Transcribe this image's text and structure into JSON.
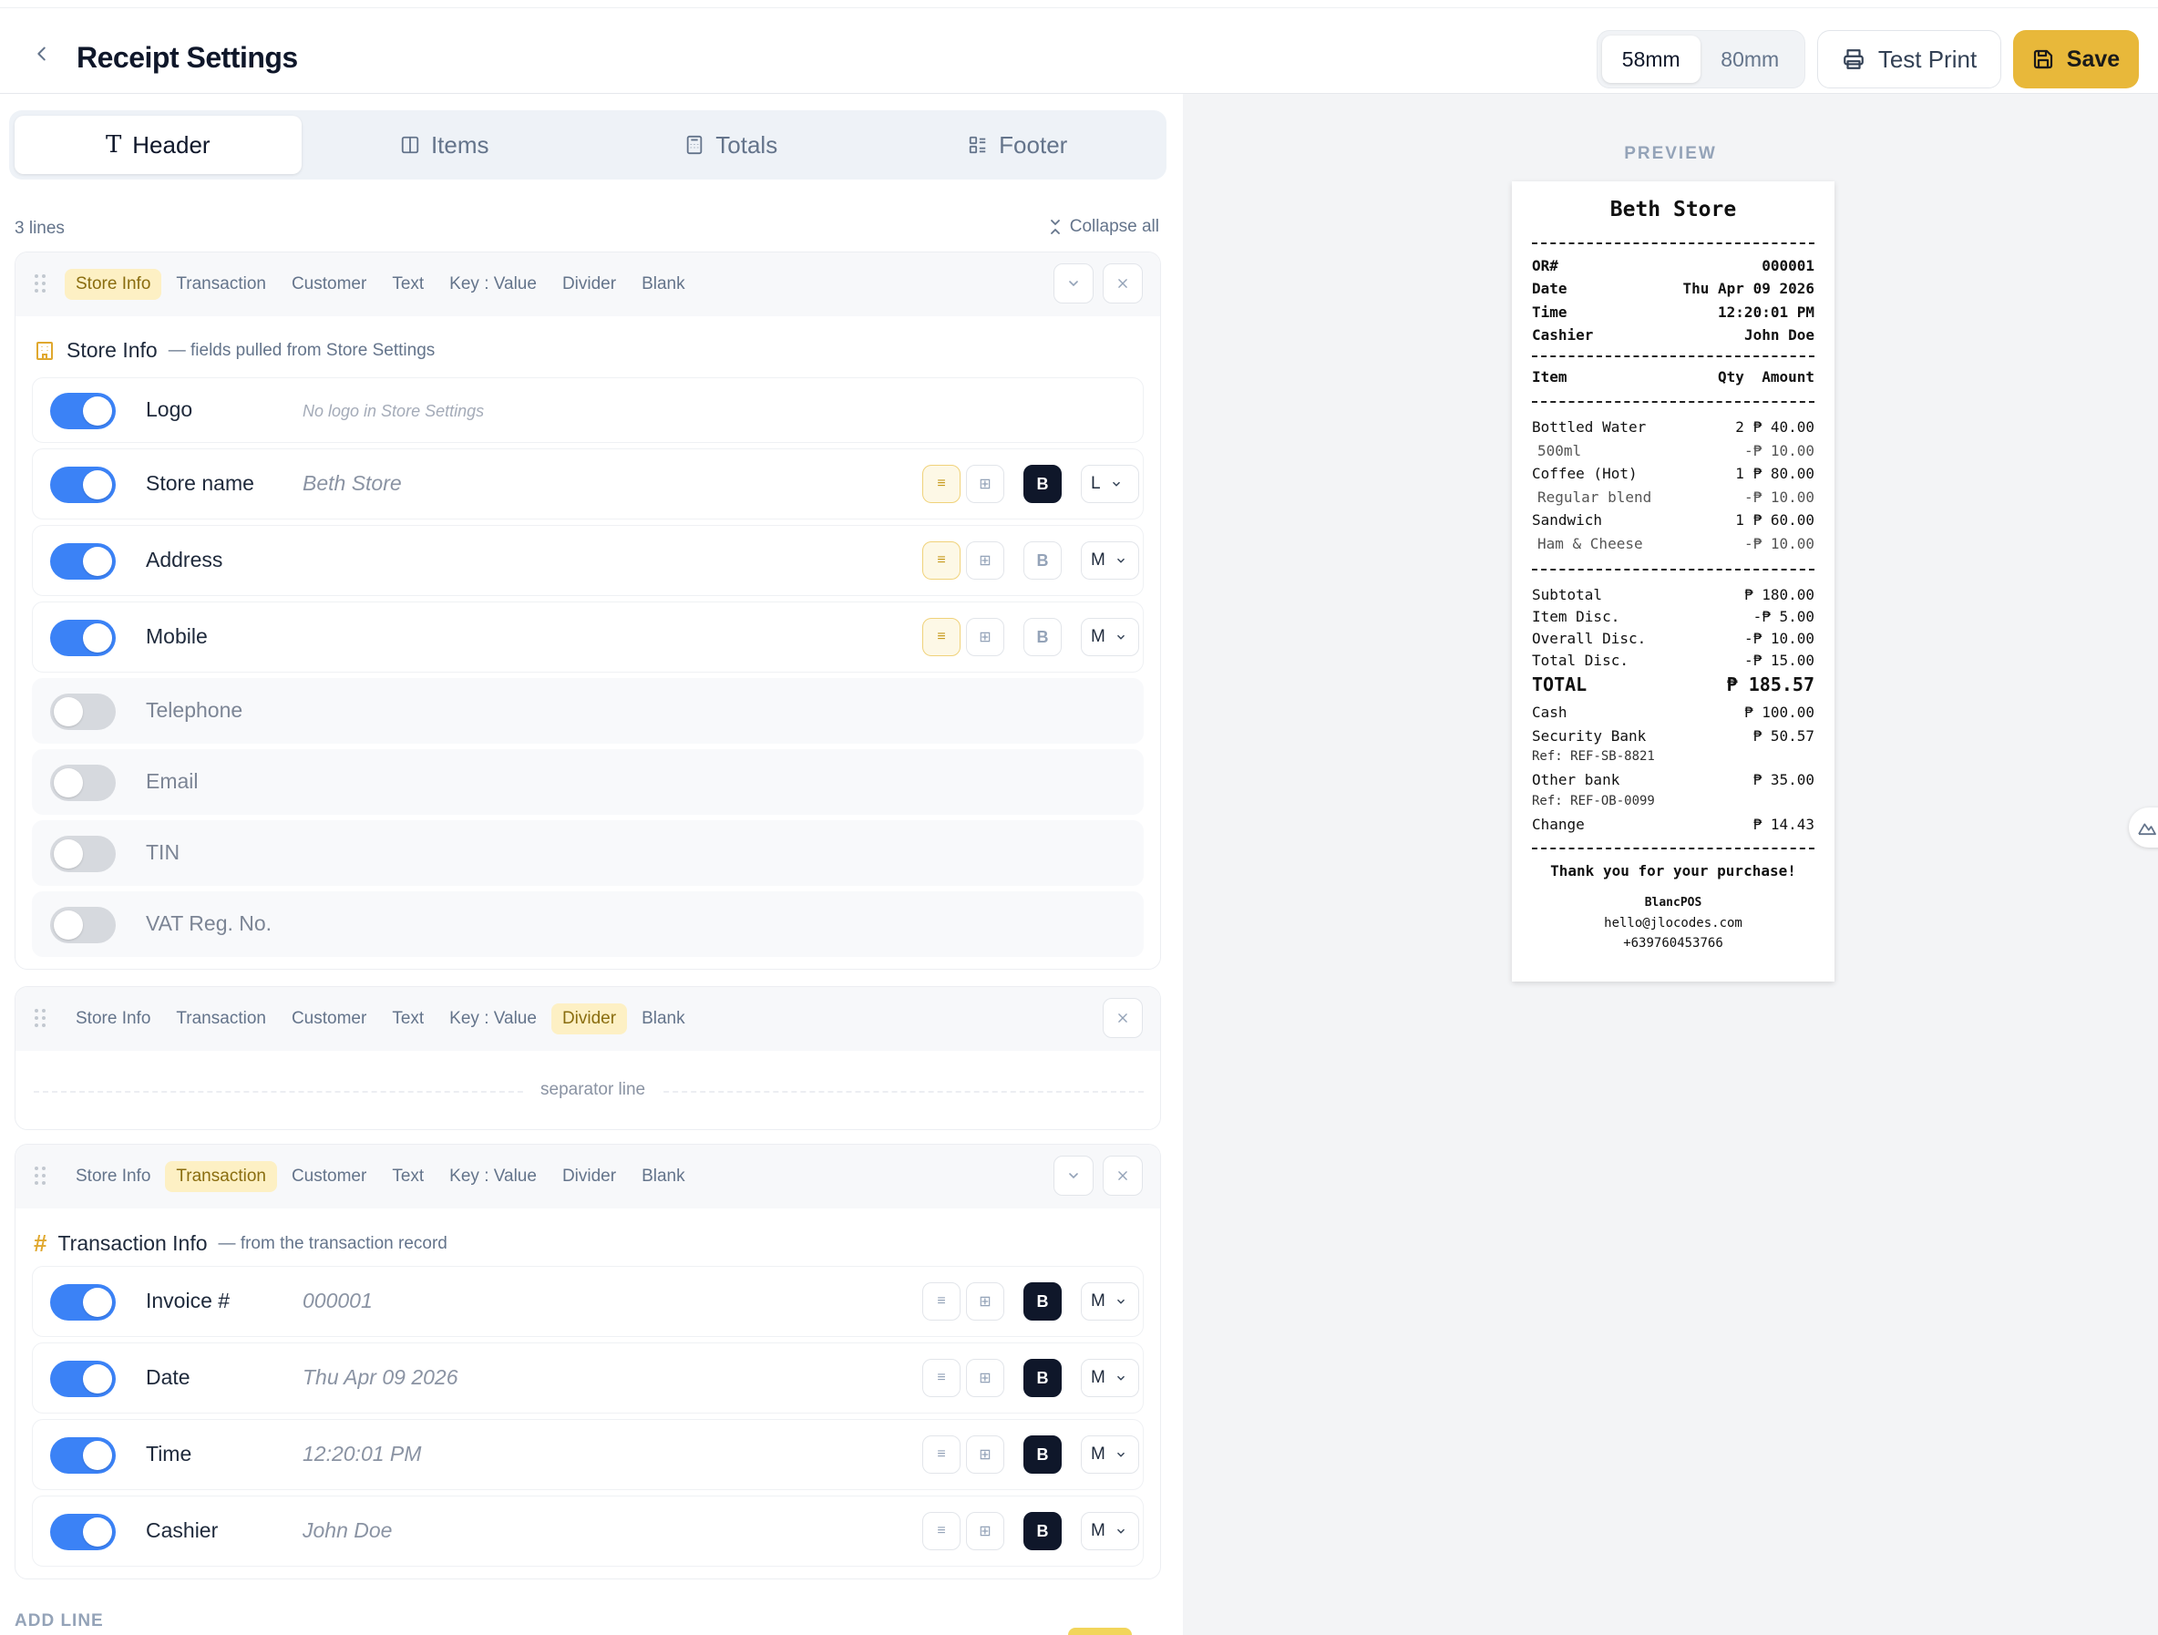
{
  "header": {
    "title": "Receipt Settings",
    "widths": [
      "58mm",
      "80mm"
    ],
    "selected_width": "58mm",
    "test_print_label": "Test Print",
    "save_label": "Save",
    "accent_color": "#e8b83a"
  },
  "tabs": [
    {
      "label": "Header",
      "icon": "text-icon",
      "active": true
    },
    {
      "label": "Items",
      "icon": "columns-icon",
      "active": false
    },
    {
      "label": "Totals",
      "icon": "calculator-icon",
      "active": false
    },
    {
      "label": "Footer",
      "icon": "list-icon",
      "active": false
    }
  ],
  "editor": {
    "lines_count": "3 lines",
    "collapse_all_label": "Collapse all",
    "add_line_label": "ADD LINE",
    "line_types": [
      "Store Info",
      "Transaction",
      "Customer",
      "Text",
      "Key : Value",
      "Divider",
      "Blank"
    ]
  },
  "line1": {
    "type": "Store Info",
    "title": "Store Info",
    "subtitle": "— fields pulled from Store Settings",
    "fields": [
      {
        "label": "Logo",
        "enabled": true,
        "value": "No logo in Store Settings"
      },
      {
        "label": "Store name",
        "enabled": true,
        "value": "Beth Store",
        "align": "left",
        "bold": true,
        "size": "L"
      },
      {
        "label": "Address",
        "enabled": true,
        "value": "",
        "align": "left",
        "bold": false,
        "size": "M"
      },
      {
        "label": "Mobile",
        "enabled": true,
        "value": "",
        "align": "left",
        "bold": false,
        "size": "M"
      },
      {
        "label": "Telephone",
        "enabled": false
      },
      {
        "label": "Email",
        "enabled": false
      },
      {
        "label": "TIN",
        "enabled": false
      },
      {
        "label": "VAT Reg. No.",
        "enabled": false
      }
    ]
  },
  "line2": {
    "type": "Divider",
    "separator_label": "separator line"
  },
  "line3": {
    "type": "Transaction",
    "title": "Transaction Info",
    "subtitle": "— from the transaction record",
    "fields": [
      {
        "label": "Invoice #",
        "enabled": true,
        "value": "000001",
        "bold": true,
        "size": "M"
      },
      {
        "label": "Date",
        "enabled": true,
        "value": "Thu Apr 09 2026",
        "bold": true,
        "size": "M"
      },
      {
        "label": "Time",
        "enabled": true,
        "value": "12:20:01 PM",
        "bold": true,
        "size": "M"
      },
      {
        "label": "Cashier",
        "enabled": true,
        "value": "John Doe",
        "bold": true,
        "size": "M"
      }
    ]
  },
  "preview": {
    "label": "PREVIEW",
    "store_name": "Beth Store",
    "dashes": "------------------------------",
    "meta": [
      {
        "k": "OR#",
        "v": "000001"
      },
      {
        "k": "Date",
        "v": "Thu Apr 09 2026"
      },
      {
        "k": "Time",
        "v": "12:20:01 PM"
      },
      {
        "k": "Cashier",
        "v": "John Doe"
      }
    ],
    "items_header": {
      "item": "Item",
      "qty": "Qty",
      "amount": "Amount"
    },
    "items": [
      {
        "name": "Bottled Water",
        "qty": "2",
        "amount": "₱ 40.00",
        "note": "500ml",
        "disc": "-₱ 10.00"
      },
      {
        "name": "Coffee (Hot)",
        "qty": "1",
        "amount": "₱ 80.00",
        "note": "Regular blend",
        "disc": "-₱ 10.00"
      },
      {
        "name": "Sandwich",
        "qty": "1",
        "amount": "₱ 60.00",
        "note": "Ham & Cheese",
        "disc": "-₱ 10.00"
      }
    ],
    "totals": [
      {
        "k": "Subtotal",
        "v": "₱ 180.00"
      },
      {
        "k": "Item Disc.",
        "v": "-₱ 5.00"
      },
      {
        "k": "Overall Disc.",
        "v": "-₱ 10.00"
      },
      {
        "k": "Total Disc.",
        "v": "-₱ 15.00"
      }
    ],
    "grand_total": {
      "k": "TOTAL",
      "v": "₱ 185.57"
    },
    "payments": [
      {
        "k": "Cash",
        "v": "₱ 100.00",
        "ref": ""
      },
      {
        "k": "Security Bank",
        "v": "₱ 50.57",
        "ref": "Ref: REF-SB-8821"
      },
      {
        "k": "Other bank",
        "v": "₱ 35.00",
        "ref": "Ref: REF-OB-0099"
      }
    ],
    "change": {
      "k": "Change",
      "v": "₱ 14.43"
    },
    "thanks": "Thank you for your purchase!",
    "footer_lines": [
      "BlancPOS",
      "hello@jlocodes.com",
      "+639760453766"
    ]
  }
}
